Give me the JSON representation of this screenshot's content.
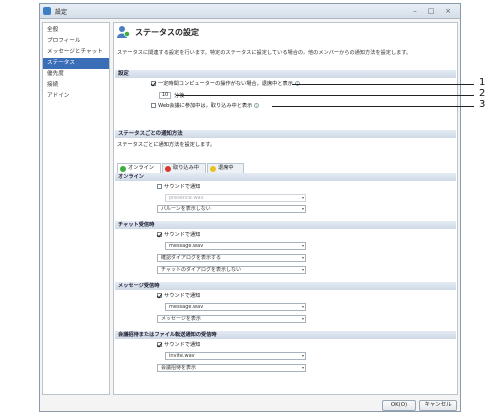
{
  "window": {
    "title": "設定",
    "controls": [
      "–",
      "□",
      "×"
    ]
  },
  "sidebar": {
    "items": [
      {
        "label": "全般",
        "selected": false
      },
      {
        "label": "プロフィール",
        "selected": false
      },
      {
        "label": "メッセージとチャット",
        "selected": false
      },
      {
        "label": "ステータス",
        "selected": true
      },
      {
        "label": "優先度",
        "selected": false
      },
      {
        "label": "接続",
        "selected": false
      },
      {
        "label": "アドイン",
        "selected": false
      }
    ]
  },
  "header": {
    "title": "ステータスの設定",
    "icon": "user-status-icon"
  },
  "description": "ステータスに関連する設定を行います。特定のステータスに設定している場合の，他のメンバーからの通知方法を設定します。",
  "settings": {
    "section": "設定",
    "idle_label": "一定時間コンピューターの操作がない場合，退席中と表示",
    "idle_checked": true,
    "minutes_value": "10",
    "minutes_unit": "分後",
    "webconf_label": "Web会議に参加中は，取り込み中と表示",
    "webconf_checked": false
  },
  "notify": {
    "section": "ステータスごとの通知方法",
    "desc": "ステータスごとに通知方法を設定します。",
    "tabs": [
      {
        "label": "オンライン",
        "color": "#3cae3c",
        "active": true
      },
      {
        "label": "取り込み中",
        "color": "#d9392b",
        "active": false
      },
      {
        "label": "退席中",
        "color": "#e8c320",
        "active": false
      }
    ],
    "online_header": "オンライン",
    "online": {
      "sound_label": "サウンドで通知",
      "sound_checked": false,
      "sound_file": "presence.wav",
      "popup": "バルーンを表示しない"
    },
    "chat": {
      "header": "チャット受信時",
      "sound_label": "サウンドで通知",
      "sound_checked": true,
      "sound_file": "message.wav",
      "dialog": "確認ダイアログを表示する",
      "dialog2": "チャットのダイアログを表示しない"
    },
    "message": {
      "header": "メッセージ受信時",
      "sound_label": "サウンドで通知",
      "sound_checked": true,
      "sound_file": "message.wav",
      "popup": "メッセージを表示"
    },
    "meeting": {
      "header": "会議招待またはファイル転送通知の受信時",
      "sound_label": "サウンドで通知",
      "sound_checked": true,
      "sound_file": "invite.wav",
      "popup": "会議招待を表示"
    }
  },
  "buttons": {
    "ok": "OK(O)",
    "cancel": "キャンセル"
  },
  "callouts": [
    "1",
    "2",
    "3"
  ]
}
